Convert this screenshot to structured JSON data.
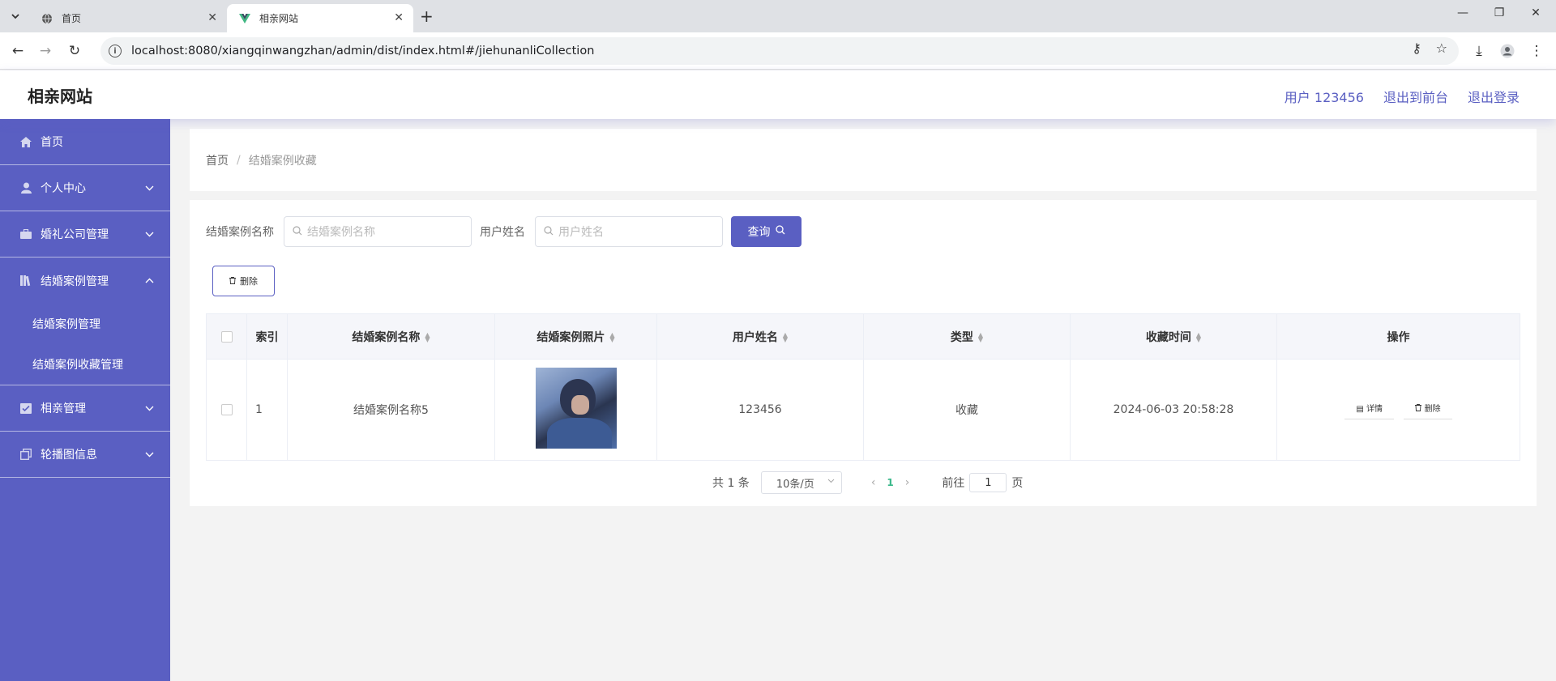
{
  "browser": {
    "tabs": [
      {
        "title": "首页",
        "favicon": "globe-icon",
        "active": false
      },
      {
        "title": "相亲网站",
        "favicon": "vue-icon",
        "active": true
      }
    ],
    "url": "localhost:8080/xiangqinwangzhan/admin/dist/index.html#/jiehunanliCollection"
  },
  "header": {
    "site_title": "相亲网站",
    "user_label": "用户 123456",
    "back_to_front": "退出到前台",
    "logout": "退出登录"
  },
  "sidebar": {
    "items": [
      {
        "label": "首页",
        "icon": "home-icon"
      },
      {
        "label": "个人中心",
        "icon": "user-icon"
      },
      {
        "label": "婚礼公司管理",
        "icon": "briefcase-icon"
      },
      {
        "label": "结婚案例管理",
        "icon": "books-icon",
        "expanded": true,
        "children": [
          {
            "label": "结婚案例管理"
          },
          {
            "label": "结婚案例收藏管理"
          }
        ]
      },
      {
        "label": "相亲管理",
        "icon": "checklist-icon"
      },
      {
        "label": "轮播图信息",
        "icon": "copy-icon"
      }
    ]
  },
  "breadcrumb": {
    "home": "首页",
    "separator": "/",
    "current": "结婚案例收藏"
  },
  "search": {
    "case_name_label": "结婚案例名称",
    "case_name_placeholder": "结婚案例名称",
    "user_name_label": "用户姓名",
    "user_name_placeholder": "用户姓名",
    "query_label": "查询"
  },
  "actions": {
    "delete_label": "删除"
  },
  "table": {
    "columns": [
      "索引",
      "结婚案例名称",
      "结婚案例照片",
      "用户姓名",
      "类型",
      "收藏时间",
      "操作"
    ],
    "rows": [
      {
        "index": "1",
        "case_name": "结婚案例名称5",
        "user_name": "123456",
        "type": "收藏",
        "time": "2024-06-03 20:58:28",
        "detail_label": "详情",
        "delete_label": "删除"
      }
    ]
  },
  "pagination": {
    "total_text": "共 1 条",
    "page_size": "10条/页",
    "current_page": "1",
    "goto_label": "前往",
    "goto_value": "1",
    "page_suffix": "页"
  },
  "colors": {
    "accent": "#5a5fc2",
    "page_active": "#39b88a"
  }
}
